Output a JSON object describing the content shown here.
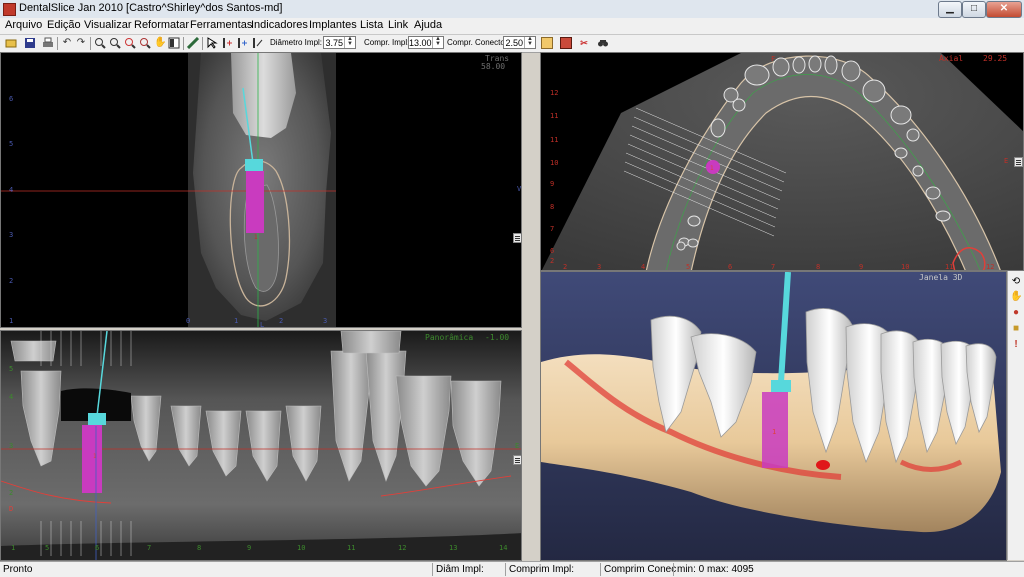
{
  "window": {
    "title": "DentalSlice Jan 2010 [Castro^Shirley^dos Santos-md]",
    "minimize_glyph": "▁",
    "maximize_glyph": "□",
    "close_glyph": "✕"
  },
  "menu": [
    "Arquivo",
    "Edição",
    "Visualizar",
    "Reformatar",
    "Ferramentas",
    "Indicadores",
    "Implantes",
    "Lista",
    "Link",
    "Ajuda"
  ],
  "toolbar": {
    "diametro_label": "Diâmetro Impl:",
    "diametro_value": "3.75",
    "comprimento_label": "Compr. Impl:",
    "comprimento_value": "13.00",
    "conector_label": "Compr. Conector:",
    "conector_value": "2.50"
  },
  "icons": {
    "open": "folder-open-icon",
    "save": "save-icon",
    "undo": "undo-icon",
    "redo": "redo-icon",
    "zoom_in": "zoom-in-icon",
    "zoom_out": "zoom-out-icon",
    "pan": "pan-hand-icon"
  },
  "trans_view": {
    "label": "Trans",
    "value": "58.00",
    "y_ticks": [
      "6",
      "5",
      "4",
      "3",
      "2",
      "1"
    ],
    "x_ticks": [
      "0",
      "1",
      "2",
      "3"
    ],
    "implant_number": "1",
    "side_letter": "V",
    "side_letter_bottom": "L"
  },
  "axial_view": {
    "label": "Axial",
    "value": "29.25",
    "y_ticks": [
      "12",
      "11",
      "10",
      "9",
      "8",
      "7",
      "6",
      "5",
      "4",
      "3",
      "2"
    ],
    "x_ticks": [
      "2",
      "3",
      "4",
      "5",
      "6",
      "7",
      "8",
      "9",
      "10",
      "11",
      "12",
      "13",
      "14"
    ],
    "top_letter": "F",
    "right_letter": "E"
  },
  "panoramic_view": {
    "label": "Panorâmica",
    "value": "-1.00",
    "y_ticks": [
      "5",
      "4",
      "3",
      "2"
    ],
    "x_ticks": [
      "1",
      "5",
      "6",
      "7",
      "8",
      "9",
      "10",
      "11",
      "12",
      "13",
      "14"
    ],
    "implant_number": "1",
    "right_letter": "E",
    "bottom_left_letter": "D"
  },
  "view3d": {
    "label": "Janela 3D",
    "implant_number": "1"
  },
  "right_tools": [
    "reset-view-icon",
    "hand-icon",
    "mask-icon",
    "clip-icon",
    "alert-icon"
  ],
  "status": {
    "ready": "Pronto",
    "diam": "Diâm Impl:",
    "comp": "Comprim Impl:",
    "comp_con": "Comprim Conec",
    "minmax": "min: 0  max: 4095"
  },
  "colors": {
    "implant_body": "#c93bbf",
    "implant_connector": "#57d8dc",
    "nerve": "#e0403a",
    "grid_line": "#c03028",
    "label_green": "#3c8a2c"
  }
}
